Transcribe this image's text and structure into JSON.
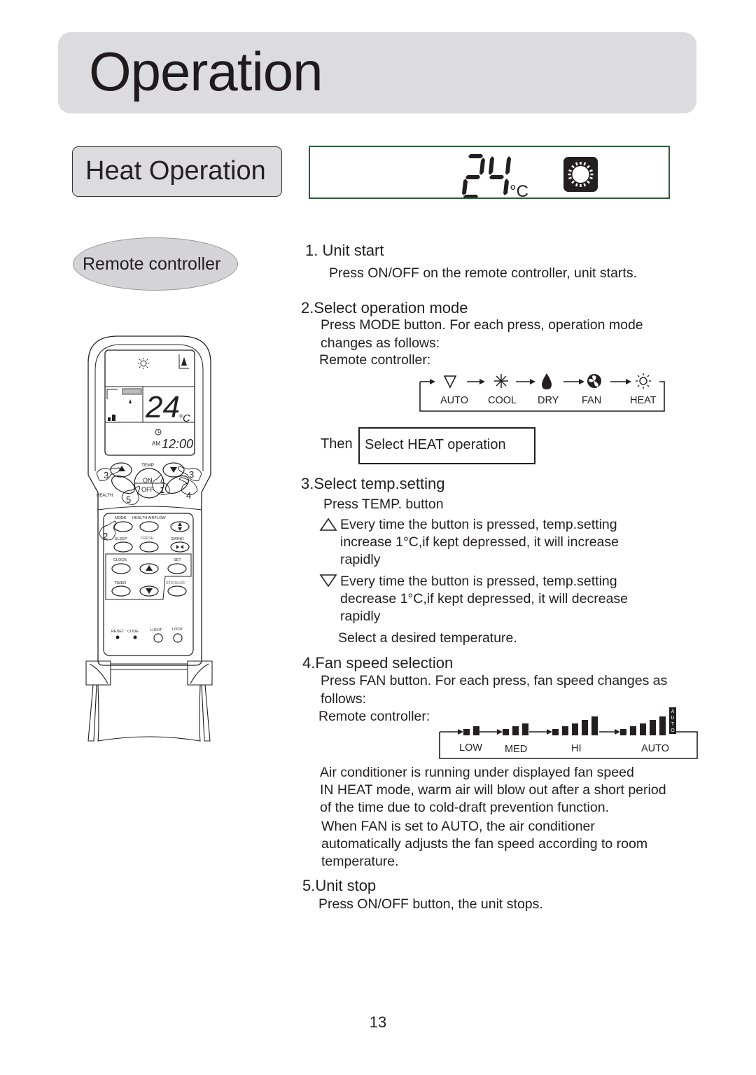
{
  "page": {
    "title": "Operation",
    "section": "Heat Operation",
    "page_number": "13"
  },
  "lcd_display": {
    "temperature": "24",
    "unit": "°C",
    "mode_icon": "heat-sun-icon"
  },
  "remote": {
    "oval_label": "Remote controller",
    "screen": {
      "temperature": "24",
      "unit": "°C",
      "ampm": "AM",
      "clock": "12:00"
    },
    "buttons": {
      "temp": "TEMP",
      "on_off_top": "ON",
      "on_off_bottom": "OFF",
      "health": "HEALTH",
      "mode": "MODE",
      "health_airflow": "HEALTH AIRFLOW",
      "sleep": "SLEEP",
      "fresh": "FRESH",
      "swing": "SWING",
      "clock": "CLOCK",
      "set": "SET",
      "timer": "TIMER",
      "sterilize": "STERILIZE",
      "reset": "RESET",
      "code": "CODE",
      "light": "LIGHT",
      "lock": "LOCK"
    },
    "step_markers": [
      "1",
      "2",
      "3",
      "3",
      "4",
      "5"
    ]
  },
  "steps": [
    {
      "heading": "1. Unit start",
      "lines": [
        "Press ON/OFF on the remote controller, unit starts."
      ]
    },
    {
      "heading": "2.Select operation mode",
      "lines": [
        "Press MODE button. For each press, operation mode",
        "changes as follows:"
      ],
      "sub_label": "Remote controller:",
      "mode_cycle": [
        {
          "label": "AUTO",
          "icon": "auto-cycle-icon"
        },
        {
          "label": "COOL",
          "icon": "snowflake-icon"
        },
        {
          "label": "DRY",
          "icon": "water-drop-icon"
        },
        {
          "label": "FAN",
          "icon": "fan-icon"
        },
        {
          "label": "HEAT",
          "icon": "sun-icon"
        }
      ],
      "then_prefix": "Then",
      "then_box": "Select HEAT operation"
    },
    {
      "heading": "3.Select temp.setting",
      "lines": [
        "Press TEMP. button"
      ],
      "up": [
        "Every time the button is pressed, temp.setting",
        "increase 1°C,if kept depressed, it will increase",
        "rapidly"
      ],
      "down": [
        "Every time the button is pressed, temp.setting",
        "decrease 1°C,if kept depressed, it will decrease",
        "rapidly"
      ],
      "footer": "Select a desired temperature."
    },
    {
      "heading": "4.Fan speed selection",
      "lines": [
        "Press FAN button. For each press, fan speed changes as",
        "follows:"
      ],
      "sub_label": "Remote controller:",
      "fan_cycle": [
        {
          "label": "LOW",
          "bars": 2
        },
        {
          "label": "MED",
          "bars": 3
        },
        {
          "label": "HI",
          "bars": 5
        },
        {
          "label": "AUTO",
          "bars": 5,
          "tag": "AUTO"
        }
      ],
      "notes": [
        "Air conditioner is running under displayed fan speed",
        "IN HEAT mode, warm air will blow out after a short period",
        "of the time due to cold-draft prevention function.",
        "When FAN is set to AUTO, the air conditioner",
        "automatically adjusts the fan speed according to room",
        "temperature."
      ]
    },
    {
      "heading": "5.Unit stop",
      "lines": [
        "Press ON/OFF button, the unit stops."
      ]
    }
  ]
}
